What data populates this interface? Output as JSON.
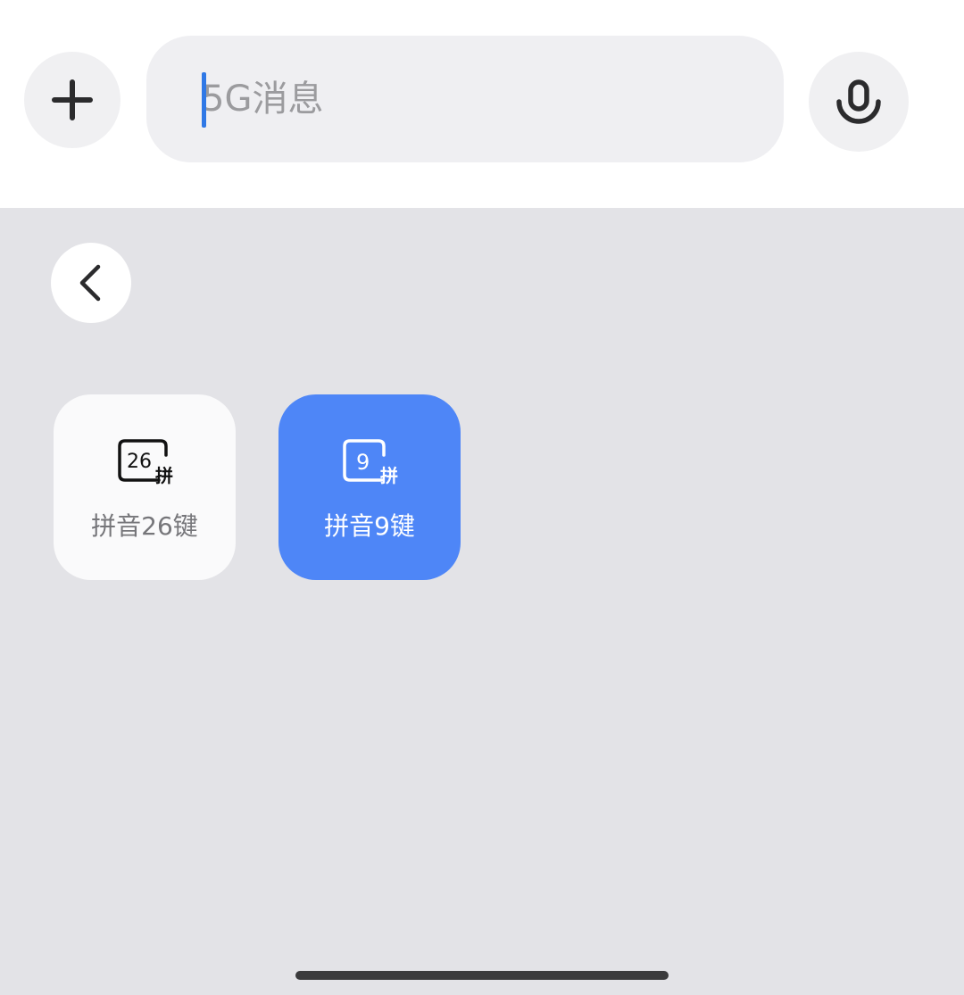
{
  "input": {
    "placeholder": "5G消息"
  },
  "icons": {
    "add": "plus-icon",
    "mic": "microphone-icon",
    "back": "chevron-left-icon"
  },
  "keyboards": [
    {
      "label": "拼音26键",
      "icon_number": "26",
      "icon_char": "拼",
      "selected": false
    },
    {
      "label": "拼音9键",
      "icon_number": "9",
      "icon_char": "拼",
      "selected": true
    }
  ],
  "colors": {
    "accent": "#4e86f7",
    "caret": "#2f78e6",
    "panel_bg": "#e3e3e7"
  }
}
